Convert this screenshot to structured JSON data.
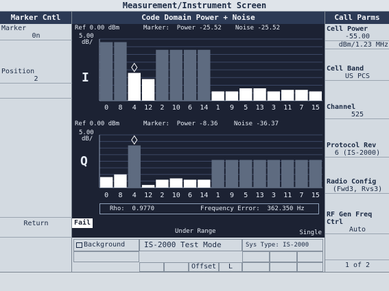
{
  "window": {
    "title": "Measurement/Instrument Screen"
  },
  "left_panel": {
    "header": "Marker Cntl",
    "marker_label": "Marker",
    "marker_value": "0n",
    "position_label": "Position",
    "position_value": "2",
    "return_label": "Return"
  },
  "center": {
    "title": "Code Domain Power + Noise",
    "i_channel": {
      "ref": "Ref 0.00 dBm",
      "marker": "Marker:  Power -25.52",
      "noise": "Noise -25.52",
      "scale": "5.00",
      "scale_unit": "dB/",
      "label": "I"
    },
    "q_channel": {
      "ref": "Ref 0.00 dBm",
      "marker": "Marker:  Power -8.36",
      "noise": "Noise -36.37",
      "scale": "5.00",
      "scale_unit": "dB/",
      "label": "Q"
    },
    "tick_labels": [
      "0",
      "8",
      "4",
      "12",
      "2",
      "10",
      "6",
      "14",
      "1",
      "9",
      "5",
      "13",
      "3",
      "11",
      "7",
      "15"
    ],
    "rho": "Rho:  0.9770",
    "freq_error": "Frequency Error:  362.350 Hz",
    "fail_badge": "Fail",
    "under_range": "Under Range",
    "single": "Single"
  },
  "right_panel": {
    "header": "Call Parms",
    "cell_power_label": "Cell Power",
    "cell_power_value": "-55.00",
    "cell_power_unit": "dBm/1.23 MHz",
    "cell_band_label": "Cell Band",
    "cell_band_value": "US PCS",
    "channel_label": "Channel",
    "channel_value": "525",
    "protocol_label": "Protocol Rev",
    "protocol_value": "6 (IS-2000)",
    "radio_label": "Radio Config",
    "radio_value": "(Fwd3, Rvs3)",
    "rf_gen_label": "RF Gen Freq Ctrl",
    "rf_gen_value": "Auto",
    "page": "1 of 2"
  },
  "bottom_bar": {
    "background_label": "Background",
    "mode": "IS-2000 Test Mode",
    "sys_type": "Sys Type: IS-2000",
    "offset": "Offset",
    "l_label": "L"
  },
  "chart_data": [
    {
      "type": "bar",
      "title": "I",
      "categories": [
        "0",
        "8",
        "4",
        "12",
        "2",
        "10",
        "6",
        "14",
        "1",
        "9",
        "5",
        "13",
        "3",
        "11",
        "7",
        "15"
      ],
      "values": [
        -2,
        -2,
        -22,
        -26,
        -7,
        -7,
        -7,
        -7,
        -34,
        -34,
        -32,
        -32,
        -34,
        -33,
        -33,
        -34
      ],
      "highlighted": [
        true,
        true,
        false,
        false,
        true,
        true,
        true,
        true,
        false,
        false,
        false,
        false,
        false,
        false,
        false,
        false
      ],
      "ylim": [
        -40,
        0
      ],
      "scale": "5.00 dB/",
      "ref": "Ref 0.00 dBm",
      "marker_index": 2,
      "highlight_color": "#5e6b80",
      "bar_color": "#ffffff"
    },
    {
      "type": "bar",
      "title": "Q",
      "categories": [
        "0",
        "8",
        "4",
        "12",
        "2",
        "10",
        "6",
        "14",
        "1",
        "9",
        "5",
        "13",
        "3",
        "11",
        "7",
        "15"
      ],
      "values": [
        -32,
        -30,
        -8,
        -38,
        -34,
        -33,
        -34,
        -34,
        -19,
        -19,
        -19,
        -19,
        -19,
        -19,
        -19,
        -19
      ],
      "highlighted": [
        false,
        false,
        true,
        false,
        false,
        false,
        false,
        false,
        true,
        true,
        true,
        true,
        true,
        true,
        true,
        true
      ],
      "ylim": [
        -40,
        0
      ],
      "scale": "5.00 dB/",
      "ref": "Ref 0.00 dBm",
      "marker_index": 2,
      "highlight_color": "#5e6b80",
      "bar_color": "#ffffff"
    }
  ]
}
